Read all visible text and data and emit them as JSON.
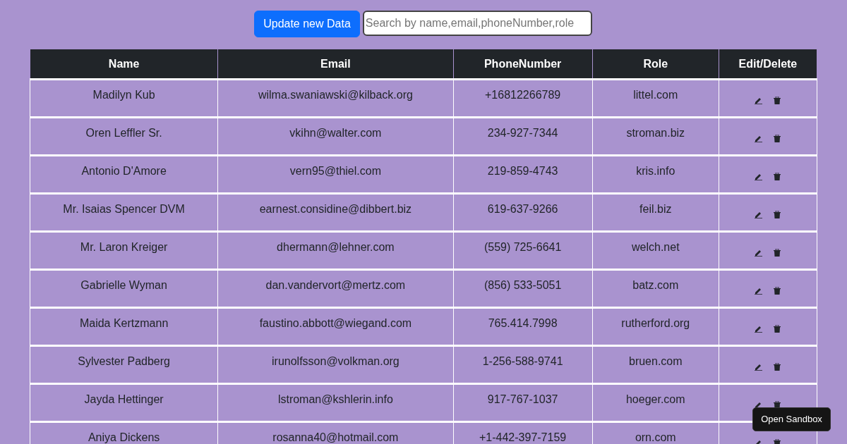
{
  "toolbar": {
    "update_button": "Update new Data",
    "search": {
      "placeholder": "Search by name,email,phoneNumber,role"
    }
  },
  "table": {
    "columns": [
      "Name",
      "Email",
      "PhoneNumber",
      "Role",
      "Edit/Delete"
    ],
    "rows": [
      {
        "name": "Madilyn Kub",
        "email": "wilma.swaniawski@kilback.org",
        "phone": "+16812266789",
        "role": "littel.com"
      },
      {
        "name": "Oren Leffler Sr.",
        "email": "vkihn@walter.com",
        "phone": "234-927-7344",
        "role": "stroman.biz"
      },
      {
        "name": "Antonio D'Amore",
        "email": "vern95@thiel.com",
        "phone": "219-859-4743",
        "role": "kris.info"
      },
      {
        "name": "Mr. Isaias Spencer DVM",
        "email": "earnest.considine@dibbert.biz",
        "phone": "619-637-9266",
        "role": "feil.biz"
      },
      {
        "name": "Mr. Laron Kreiger",
        "email": "dhermann@lehner.com",
        "phone": "(559) 725-6641",
        "role": "welch.net"
      },
      {
        "name": "Gabrielle Wyman",
        "email": "dan.vandervort@mertz.com",
        "phone": "(856) 533-5051",
        "role": "batz.com"
      },
      {
        "name": "Maida Kertzmann",
        "email": "faustino.abbott@wiegand.com",
        "phone": "765.414.7998",
        "role": "rutherford.org"
      },
      {
        "name": "Sylvester Padberg",
        "email": "irunolfsson@volkman.org",
        "phone": "1-256-588-9741",
        "role": "bruen.com"
      },
      {
        "name": "Jayda Hettinger",
        "email": "lstroman@kshlerin.info",
        "phone": "917-767-1037",
        "role": "hoeger.com"
      },
      {
        "name": "Aniya Dickens",
        "email": "rosanna40@hotmail.com",
        "phone": "+1-442-397-7159",
        "role": "orn.com"
      }
    ]
  },
  "sandbox_button": "Open Sandbox"
}
